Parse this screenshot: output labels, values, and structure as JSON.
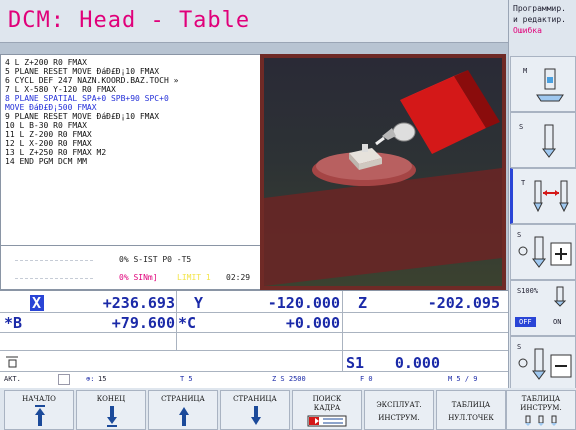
{
  "header": {
    "title": "DCM: Head - Table"
  },
  "mode": {
    "line1": "Программир.",
    "line2": "и редактир.",
    "line3": "Ошибка"
  },
  "program": {
    "lines": [
      "4  L  Z+200 R0 FMAX",
      "5  PLANE RESET MOVE ÐáÐ£Ð¡10 FMAX",
      "6  CYCL DEF 247 NAZN.KOORD.BAZ.TOCH »",
      "7  L  X-580  Y-120 R0 FMAX",
      "8  PLANE SPATIAL SPA+0 SPB+90 SPC+0",
      "   MOVE ÐáÐ£Ð¡500 FMAX",
      "9  PLANE RESET MOVE ÐáÐ£Ð¡10 FMAX",
      "10 L  B-30 R0 FMAX",
      "11 L  Z-200 R0 FMAX",
      "12 L  X-200 R0 FMAX",
      "13 L  Z+250 R0 FMAX M2",
      "14 END PGM DCM MM"
    ]
  },
  "status": {
    "line1": "0% S-IST P0  -T5",
    "line2_left": "0% SINm]",
    "line2_limit": "LIMIT 1",
    "line2_time": "02:29"
  },
  "positions": {
    "x_label": "X",
    "x_value": "+236.693",
    "y_label": "Y",
    "y_value": "-120.000",
    "z_label": "Z",
    "z_value": "-202.095",
    "b_label": "*B",
    "b_value": "+79.600",
    "c_label": "*C",
    "c_value": "+0.000",
    "s1_label": "S1",
    "s1_value": "0.000"
  },
  "statusbar": {
    "mode": "AKT.",
    "feed_icon": "15",
    "tool": "T 5",
    "spindle": "Z S 2500",
    "feed": "F 0",
    "m": "M 5 / 9"
  },
  "side": {
    "m_label": "M",
    "s_label": "S",
    "t_label": "T",
    "s_label2": "S",
    "s100_label": "S100%",
    "off_label": "OFF",
    "on_label": "ON",
    "s_label3": "S"
  },
  "softkeys": {
    "k1": "НАЧАЛО",
    "k2": "КОНЕЦ",
    "k3": "СТРАНИЦА",
    "k4": "СТРАНИЦА",
    "k5a": "ПОИСК",
    "k5b": "КАДРА",
    "k6a": "ЭКСПЛУАТ.",
    "k6b": "ИНСТРУМ.",
    "k7a": "ТАБЛИЦА",
    "k7b": "НУЛ.ТОЧЕК",
    "k8a": "ТАБЛИЦА",
    "k8b": "ИНСТРУМ."
  }
}
